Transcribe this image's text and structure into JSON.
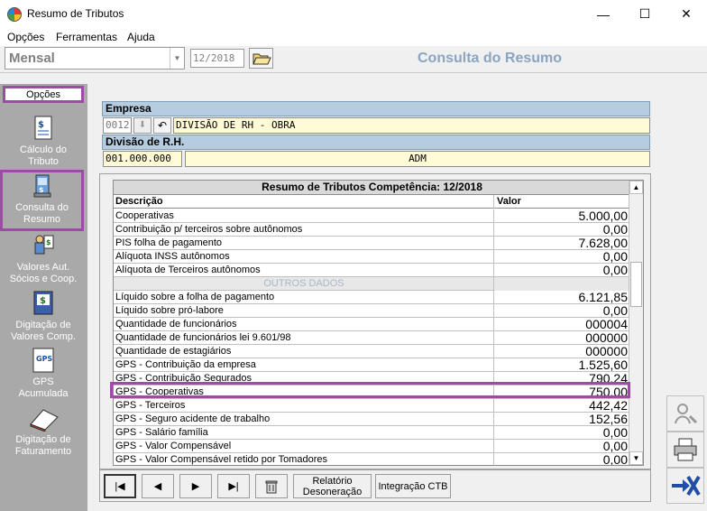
{
  "window": {
    "title": "Resumo de Tributos",
    "minimize": "—",
    "maximize": "☐",
    "close": "✕"
  },
  "menu": {
    "items": [
      "Opções",
      "Ferramentas",
      "Ajuda"
    ]
  },
  "toolbar": {
    "period": "Mensal",
    "date": "12/2018",
    "screen_title": "Consulta do Resumo"
  },
  "sidebar": {
    "header": "Opções",
    "items": [
      {
        "label": "Cálculo do\nTributo",
        "icon": "calculation-document-icon"
      },
      {
        "label": "Consulta do\nResumo",
        "icon": "computer-consult-icon"
      },
      {
        "label": "Valores Aut.\nSócios e  Coop.",
        "icon": "people-money-icon"
      },
      {
        "label": "Digitação de\nValores Comp.",
        "icon": "money-document-icon"
      },
      {
        "label": "GPS\nAcumulada",
        "icon": "gps-document-icon"
      },
      {
        "label": "Digitação de\nFaturamento",
        "icon": "notebook-icon"
      }
    ]
  },
  "empresa": {
    "label": "Empresa",
    "code": "0012",
    "name": "DIVISÃO DE RH - OBRA"
  },
  "divisao": {
    "label": "Divisão de R.H.",
    "code": "001.000.000",
    "name": "ADM"
  },
  "grid": {
    "title": "Resumo de Tributos Competência: 12/2018",
    "col_desc": "Descrição",
    "col_val": "Valor",
    "rows": [
      {
        "desc": "Cooperativas",
        "val": "5.000,00"
      },
      {
        "desc": "Contribuição p/ terceiros sobre autônomos",
        "val": "0,00"
      },
      {
        "desc": "PIS folha de pagamento",
        "val": "7.628,00"
      },
      {
        "desc": "Alíquota INSS autônomos",
        "val": "0,00"
      },
      {
        "desc": "Alíquota de Terceiros autônomos",
        "val": "0,00"
      },
      {
        "desc": "OUTROS DADOS",
        "val": ""
      },
      {
        "desc": "Líquido sobre a folha de pagamento",
        "val": "6.121,85"
      },
      {
        "desc": "Líquido sobre pró-labore",
        "val": "0,00"
      },
      {
        "desc": "Quantidade de funcionários",
        "val": "000004"
      },
      {
        "desc": "Quantidade de funcionários lei 9.601/98",
        "val": "000000"
      },
      {
        "desc": "Quantidade de estagiários",
        "val": "000000"
      },
      {
        "desc": "GPS - Contribuição da empresa",
        "val": "1.525,60"
      },
      {
        "desc": "GPS - Contribuição Segurados",
        "val": "790,24"
      },
      {
        "desc": "GPS - Cooperativas",
        "val": "750,00"
      },
      {
        "desc": "GPS - Terceiros",
        "val": "442,42"
      },
      {
        "desc": "GPS - Seguro acidente de trabalho",
        "val": "152,56"
      },
      {
        "desc": "GPS - Salário família",
        "val": "0,00"
      },
      {
        "desc": "GPS - Valor Compensável",
        "val": "0,00"
      },
      {
        "desc": "GPS - Valor Compensável retido por Tomadores",
        "val": "0,00"
      }
    ]
  },
  "bottom": {
    "first": "|◀",
    "prev": "◀",
    "next": "▶",
    "last": "▶|",
    "report": "Relatório\nDesoneração",
    "integration": "Integração CTB"
  },
  "colors": {
    "highlight": "#9b4ea1",
    "header_blue": "#b6cde0",
    "field_yellow": "#fffbd6",
    "sidebar_gray": "#a9a9a9"
  }
}
